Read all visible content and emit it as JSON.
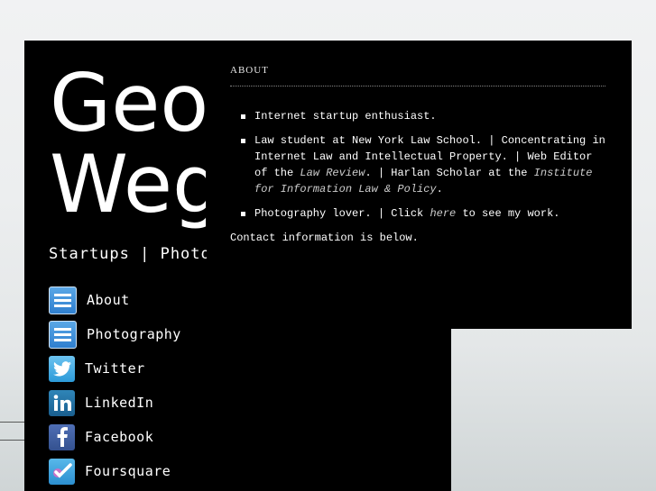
{
  "site": {
    "title_line1": "George",
    "title_line2": "Wegner",
    "tagline": "Startups | Photography"
  },
  "nav": {
    "items": [
      {
        "label": "About",
        "icon": "menu-icon"
      },
      {
        "label": "Photography",
        "icon": "menu-icon"
      },
      {
        "label": "Twitter",
        "icon": "twitter-icon"
      },
      {
        "label": "LinkedIn",
        "icon": "linkedin-icon"
      },
      {
        "label": "Facebook",
        "icon": "facebook-icon"
      },
      {
        "label": "Foursquare",
        "icon": "foursquare-icon"
      }
    ]
  },
  "about": {
    "heading": "ABOUT",
    "bullet1": "Internet startup enthusiast.",
    "bullet2_a": "Law student at New York Law School. | Concentrating in Internet Law and Intellectual Property. | Web Editor of the ",
    "bullet2_law_review": "Law Review",
    "bullet2_b": ". | Harlan Scholar at the ",
    "bullet2_institute": "Institute for Information Law & Policy",
    "bullet2_c": ".",
    "bullet3_a": "Photography lover. | Click ",
    "bullet3_link": "here",
    "bullet3_b": " to see my work.",
    "contact": "Contact information is below."
  },
  "colors": {
    "panel": "#000000",
    "text": "#ffffff"
  }
}
